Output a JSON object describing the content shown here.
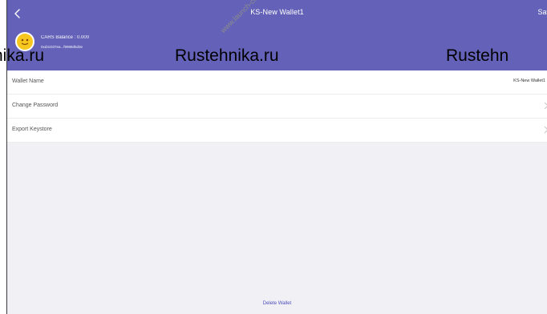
{
  "header": {
    "title": "KS-New Wallet1",
    "save_label": "Sav",
    "balance_text": "CARS Balance : 0.000",
    "address_text": "0xd3c037ea...f9988d5d3e"
  },
  "watermarks": {
    "row": [
      "nika.ru",
      "Rustehnika.ru",
      "Rustehn"
    ],
    "diagonal": "www.launch-cis.ru"
  },
  "settings": {
    "wallet_name_label": "Wallet Name",
    "wallet_name_value": "KS-New Wallet1",
    "change_password_label": "Change Password",
    "export_keystore_label": "Export Keystore"
  },
  "footer": {
    "delete_label": "Delete Wallet"
  },
  "colors": {
    "header_bg": "#6462b8",
    "accent": "#4f4dbb"
  }
}
